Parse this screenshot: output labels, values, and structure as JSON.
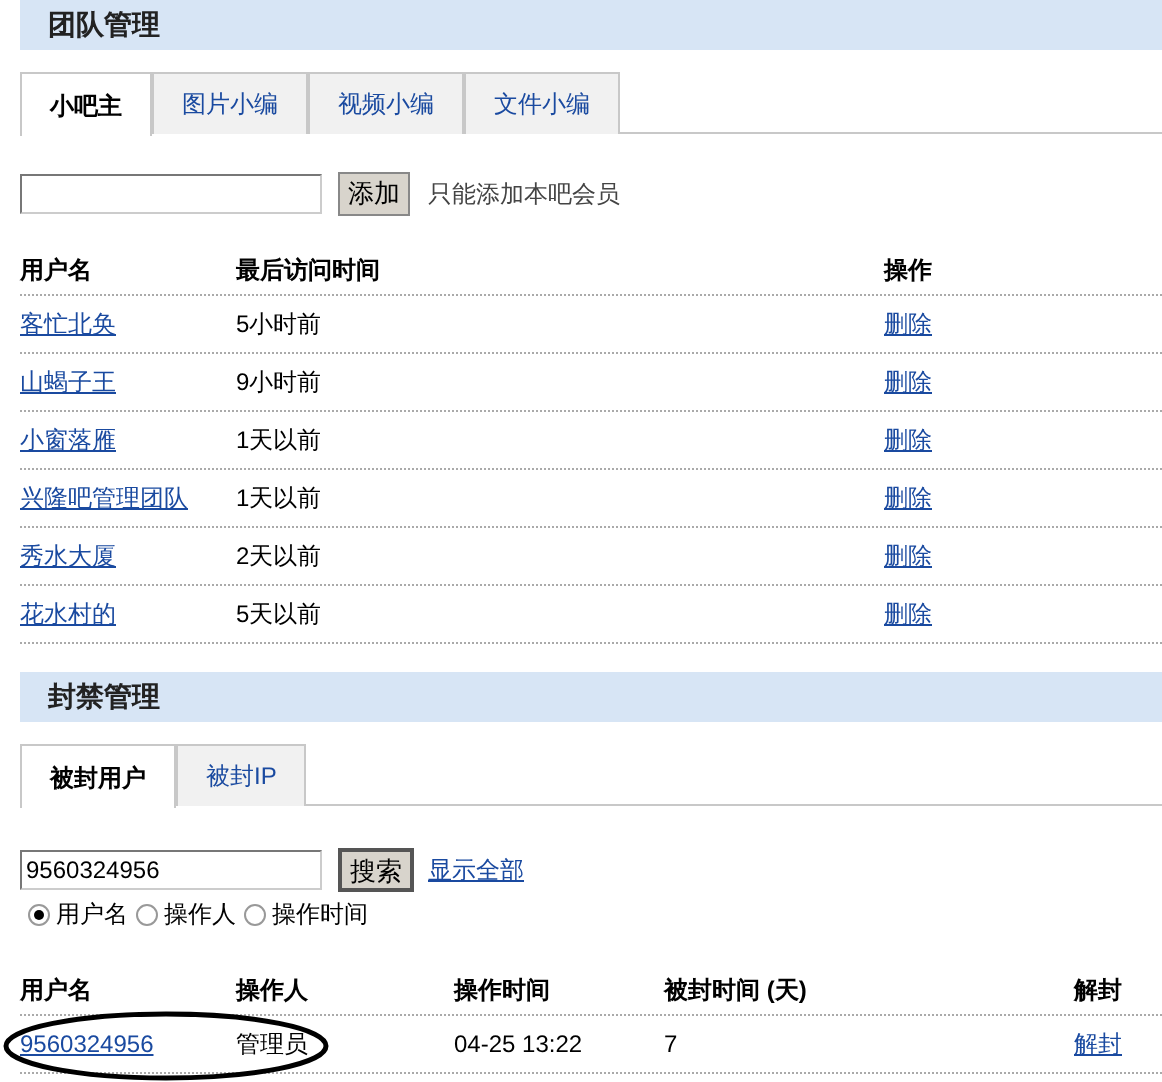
{
  "team": {
    "title": "团队管理",
    "tabs": [
      {
        "label": "小吧主",
        "selected": true
      },
      {
        "label": "图片小编",
        "selected": false
      },
      {
        "label": "视频小编",
        "selected": false
      },
      {
        "label": "文件小编",
        "selected": false
      }
    ],
    "add": {
      "button": "添加",
      "hint": "只能添加本吧会员"
    },
    "columns": [
      "用户名",
      "最后访问时间",
      "操作"
    ],
    "rows": [
      {
        "user": "客忙北奂",
        "last_visit": "5小时前",
        "action": "删除"
      },
      {
        "user": "山蝎子王",
        "last_visit": "9小时前",
        "action": "删除"
      },
      {
        "user": "小窗落雁",
        "last_visit": "1天以前",
        "action": "删除"
      },
      {
        "user": "兴隆吧管理团队",
        "last_visit": "1天以前",
        "action": "删除"
      },
      {
        "user": "秀水大厦",
        "last_visit": "2天以前",
        "action": "删除"
      },
      {
        "user": "花水村的",
        "last_visit": "5天以前",
        "action": "删除"
      }
    ]
  },
  "ban": {
    "title": "封禁管理",
    "tabs": [
      {
        "label": "被封用户",
        "selected": true
      },
      {
        "label": "被封IP",
        "selected": false
      }
    ],
    "search": {
      "value": "9560324956",
      "button": "搜索",
      "show_all": "显示全部"
    },
    "radios": [
      {
        "label": "用户名",
        "selected": true
      },
      {
        "label": "操作人",
        "selected": false
      },
      {
        "label": "操作时间",
        "selected": false
      }
    ],
    "columns": [
      "用户名",
      "操作人",
      "操作时间",
      "被封时间 (天)",
      "解封"
    ],
    "rows": [
      {
        "user": "9560324956",
        "operator": "管理员",
        "time": "04-25 13:22",
        "days": "7",
        "action": "解封",
        "circled": true
      }
    ]
  }
}
